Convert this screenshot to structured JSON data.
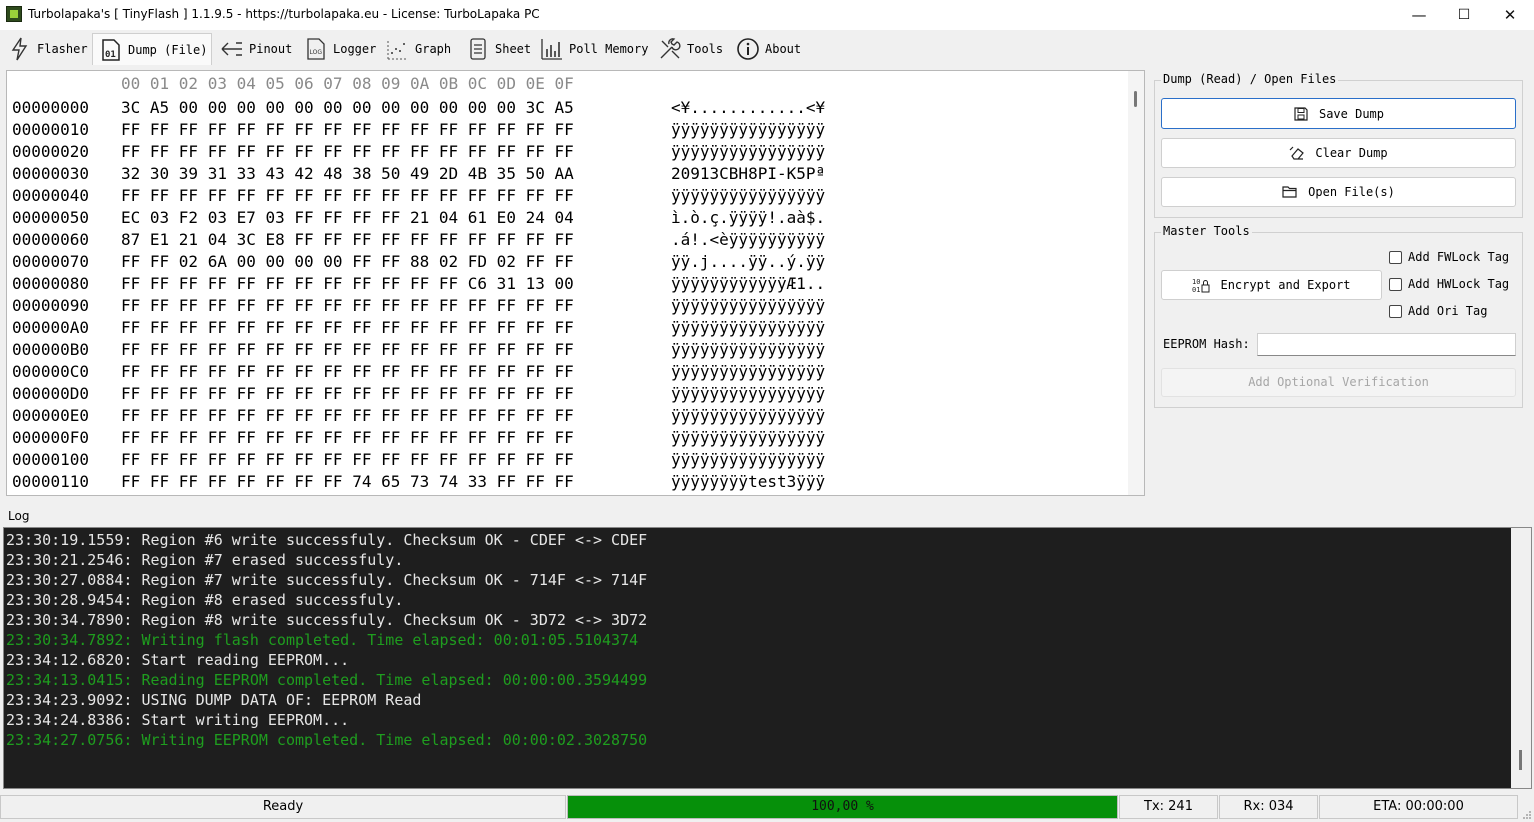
{
  "window": {
    "title": "Turbolapaka's [ TinyFlash ] 1.1.9.5 - https://turbolapaka.eu - License: TurboLapaka PC",
    "minimize": "—",
    "maximize": "☐",
    "close": "✕"
  },
  "tabs": [
    {
      "label": "Flasher",
      "icon": "lightning-icon"
    },
    {
      "label": "Dump (File)",
      "icon": "file-01-icon",
      "active": true
    },
    {
      "label": "Pinout",
      "icon": "pinout-arrow-icon"
    },
    {
      "label": "Logger",
      "icon": "log-icon"
    },
    {
      "label": "Graph",
      "icon": "graph-dots-icon"
    },
    {
      "label": "Sheet",
      "icon": "sheet-icon"
    },
    {
      "label": "Poll Memory",
      "icon": "bar-chart-icon"
    },
    {
      "label": "Tools",
      "icon": "tools-icon"
    },
    {
      "label": "About",
      "icon": "info-icon"
    }
  ],
  "hex": {
    "header": "00 01 02 03 04 05 06 07 08 09 0A 0B 0C 0D 0E 0F",
    "rows": [
      {
        "addr": "00000000",
        "bytes": "3C A5 00 00 00 00 00 00 00 00 00 00 00 00 3C A5",
        "ascii": "<¥............<¥"
      },
      {
        "addr": "00000010",
        "bytes": "FF FF FF FF FF FF FF FF FF FF FF FF FF FF FF FF",
        "ascii": "ÿÿÿÿÿÿÿÿÿÿÿÿÿÿÿÿ"
      },
      {
        "addr": "00000020",
        "bytes": "FF FF FF FF FF FF FF FF FF FF FF FF FF FF FF FF",
        "ascii": "ÿÿÿÿÿÿÿÿÿÿÿÿÿÿÿÿ"
      },
      {
        "addr": "00000030",
        "bytes": "32 30 39 31 33 43 42 48 38 50 49 2D 4B 35 50 AA",
        "ascii": "20913CBH8PI-K5Pª"
      },
      {
        "addr": "00000040",
        "bytes": "FF FF FF FF FF FF FF FF FF FF FF FF FF FF FF FF",
        "ascii": "ÿÿÿÿÿÿÿÿÿÿÿÿÿÿÿÿ"
      },
      {
        "addr": "00000050",
        "bytes": "EC 03 F2 03 E7 03 FF FF FF FF 21 04 61 E0 24 04",
        "ascii": "ì.ò.ç.ÿÿÿÿ!.aà$."
      },
      {
        "addr": "00000060",
        "bytes": "87 E1 21 04 3C E8 FF FF FF FF FF FF FF FF FF FF",
        "ascii": ".á!.<èÿÿÿÿÿÿÿÿÿÿ"
      },
      {
        "addr": "00000070",
        "bytes": "FF FF 02 6A 00 00 00 00 FF FF 88 02 FD 02 FF FF",
        "ascii": "ÿÿ.j....ÿÿ..ý.ÿÿ"
      },
      {
        "addr": "00000080",
        "bytes": "FF FF FF FF FF FF FF FF FF FF FF FF C6 31 13 00",
        "ascii": "ÿÿÿÿÿÿÿÿÿÿÿÿÆ1.."
      },
      {
        "addr": "00000090",
        "bytes": "FF FF FF FF FF FF FF FF FF FF FF FF FF FF FF FF",
        "ascii": "ÿÿÿÿÿÿÿÿÿÿÿÿÿÿÿÿ"
      },
      {
        "addr": "000000A0",
        "bytes": "FF FF FF FF FF FF FF FF FF FF FF FF FF FF FF FF",
        "ascii": "ÿÿÿÿÿÿÿÿÿÿÿÿÿÿÿÿ"
      },
      {
        "addr": "000000B0",
        "bytes": "FF FF FF FF FF FF FF FF FF FF FF FF FF FF FF FF",
        "ascii": "ÿÿÿÿÿÿÿÿÿÿÿÿÿÿÿÿ"
      },
      {
        "addr": "000000C0",
        "bytes": "FF FF FF FF FF FF FF FF FF FF FF FF FF FF FF FF",
        "ascii": "ÿÿÿÿÿÿÿÿÿÿÿÿÿÿÿÿ"
      },
      {
        "addr": "000000D0",
        "bytes": "FF FF FF FF FF FF FF FF FF FF FF FF FF FF FF FF",
        "ascii": "ÿÿÿÿÿÿÿÿÿÿÿÿÿÿÿÿ"
      },
      {
        "addr": "000000E0",
        "bytes": "FF FF FF FF FF FF FF FF FF FF FF FF FF FF FF FF",
        "ascii": "ÿÿÿÿÿÿÿÿÿÿÿÿÿÿÿÿ"
      },
      {
        "addr": "000000F0",
        "bytes": "FF FF FF FF FF FF FF FF FF FF FF FF FF FF FF FF",
        "ascii": "ÿÿÿÿÿÿÿÿÿÿÿÿÿÿÿÿ"
      },
      {
        "addr": "00000100",
        "bytes": "FF FF FF FF FF FF FF FF FF FF FF FF FF FF FF FF",
        "ascii": "ÿÿÿÿÿÿÿÿÿÿÿÿÿÿÿÿ"
      },
      {
        "addr": "00000110",
        "bytes": "FF FF FF FF FF FF FF FF 74 65 73 74 33 FF FF FF",
        "ascii": "ÿÿÿÿÿÿÿÿtest3ÿÿÿ"
      }
    ]
  },
  "dump_group": {
    "title": "Dump (Read) / Open Files",
    "save_label": "Save Dump",
    "clear_label": "Clear Dump",
    "open_label": "Open File(s)"
  },
  "master_group": {
    "title": "Master Tools",
    "encrypt_label": "Encrypt and Export",
    "fwlock_label": "Add FWLock Tag",
    "hwlock_label": "Add HWLock Tag",
    "ori_label": "Add Ori Tag",
    "hash_label": "EEPROM Hash:",
    "hash_value": "",
    "verify_label": "Add Optional Verification"
  },
  "log": {
    "label": "Log",
    "colors": {
      "normal": "#e6e6e6",
      "success": "#1f9d1f"
    },
    "lines": [
      {
        "text": "23:30:19.1559: Region #6 write successfuly. Checksum OK - CDEF <-> CDEF",
        "kind": "normal"
      },
      {
        "text": "23:30:21.2546: Region #7 erased successfuly.",
        "kind": "normal"
      },
      {
        "text": "23:30:27.0884: Region #7 write successfuly. Checksum OK - 714F <-> 714F",
        "kind": "normal"
      },
      {
        "text": "23:30:28.9454: Region #8 erased successfuly.",
        "kind": "normal"
      },
      {
        "text": "23:30:34.7890: Region #8 write successfuly. Checksum OK - 3D72 <-> 3D72",
        "kind": "normal"
      },
      {
        "text": "23:30:34.7892: Writing flash completed. Time elapsed: 00:01:05.5104374",
        "kind": "success"
      },
      {
        "text": "23:34:12.6820: Start reading EEPROM...",
        "kind": "normal"
      },
      {
        "text": "23:34:13.0415: Reading EEPROM completed. Time elapsed: 00:00:00.3594499",
        "kind": "success"
      },
      {
        "text": "23:34:23.9092: USING DUMP DATA OF: EEPROM Read",
        "kind": "normal"
      },
      {
        "text": "23:34:24.8386: Start writing EEPROM...",
        "kind": "normal"
      },
      {
        "text": "23:34:27.0756: Writing EEPROM completed. Time elapsed: 00:00:02.3028750",
        "kind": "success"
      }
    ]
  },
  "status": {
    "state": "Ready",
    "progress_text": "100,00 %",
    "progress_fraction": 1.0,
    "progress_color": "#06900a",
    "tx": "Tx: 241",
    "rx": "Rx: 034",
    "eta": "ETA: 00:00:00"
  }
}
